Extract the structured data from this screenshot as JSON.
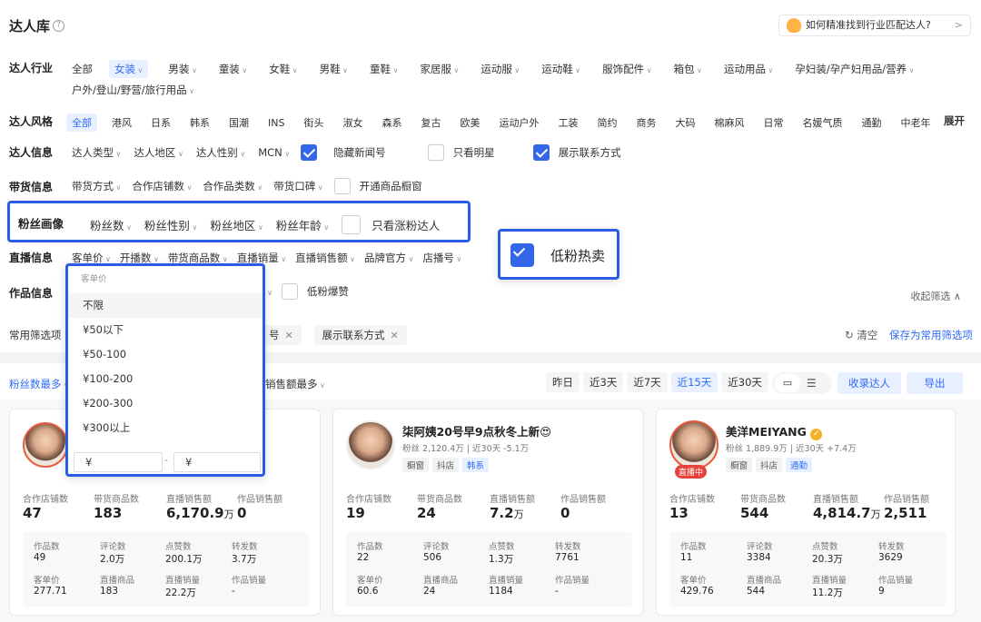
{
  "header": {
    "title": "达人库",
    "help": "?",
    "tip": "如何精准找到行业匹配达人?",
    "tip_arrow": ">"
  },
  "industry": {
    "label": "达人行业",
    "items": [
      "全部",
      "女装",
      "男装",
      "童装",
      "女鞋",
      "男鞋",
      "童鞋",
      "家居服",
      "运动服",
      "运动鞋",
      "服饰配件",
      "箱包",
      "运动用品",
      "孕妇装/孕产妇用品/营养",
      "户外/登山/野营/旅行用品"
    ]
  },
  "style": {
    "label": "达人风格",
    "items": [
      "全部",
      "港风",
      "日系",
      "韩系",
      "国潮",
      "INS",
      "街头",
      "淑女",
      "森系",
      "复古",
      "欧美",
      "运动户外",
      "工装",
      "简约",
      "商务",
      "大码",
      "棉麻风",
      "日常",
      "名媛气质",
      "通勤",
      "中老年"
    ],
    "expand": "展开"
  },
  "info": {
    "label": "达人信息",
    "dropdowns": [
      "达人类型",
      "达人地区",
      "达人性别",
      "MCN"
    ],
    "checks": [
      {
        "label": "隐藏新闻号",
        "checked": true
      },
      {
        "label": "只看明星",
        "checked": false
      },
      {
        "label": "展示联系方式",
        "checked": true
      }
    ]
  },
  "sales": {
    "label": "带货信息",
    "dropdowns": [
      "带货方式",
      "合作店铺数",
      "合作品类数",
      "带货口碑"
    ],
    "check": "开通商品橱窗"
  },
  "fans": {
    "label": "粉丝画像",
    "dropdowns": [
      "粉丝数",
      "粉丝性别",
      "粉丝地区",
      "粉丝年龄"
    ],
    "check": "只看涨粉达人"
  },
  "live": {
    "label": "直播信息",
    "dropdowns": [
      "客单价",
      "开播数",
      "带货商品数",
      "直播销量",
      "直播销售额",
      "品牌官方",
      "店播号"
    ]
  },
  "lowfans": {
    "label": "低粉热卖"
  },
  "works": {
    "label": "作品信息",
    "check": "低粉爆赞",
    "collapse": "收起筛选 ∧"
  },
  "common": {
    "label": "常用筛选项",
    "chips": [
      "号",
      "展示联系方式"
    ],
    "clear": "清空",
    "save": "保存为常用筛选项"
  },
  "price_dropdown": {
    "header": "客单价",
    "options": [
      "不限",
      "¥50以下",
      "¥50-100",
      "¥100-200",
      "¥200-300",
      "¥300以上"
    ],
    "min_placeholder": "¥",
    "max_placeholder": "¥",
    "dash": "-"
  },
  "toolbar": {
    "sort1": "粉丝数最多",
    "sort2": "销售额最多",
    "ranges": [
      "昨日",
      "近3天",
      "近7天",
      "近15天",
      "近30天"
    ],
    "active_range": "近15天",
    "collect": "收录达人",
    "export": "导出"
  },
  "cards": [
    {
      "name": "",
      "fans_line": "",
      "tags": [],
      "badge": "",
      "stats": [
        {
          "l": "合作店铺数",
          "v": "47"
        },
        {
          "l": "带货商品数",
          "v": "183"
        },
        {
          "l": "直播销售额",
          "v": "6,170.9",
          "u": "万"
        },
        {
          "l": "作品销售额",
          "v": "0"
        }
      ],
      "sub": [
        {
          "l": "作品数",
          "v": "49"
        },
        {
          "l": "评论数",
          "v": "2.0万"
        },
        {
          "l": "点赞数",
          "v": "200.1万"
        },
        {
          "l": "转发数",
          "v": "3.7万"
        },
        {
          "l": "客单价",
          "v": "277.71"
        },
        {
          "l": "直播商品",
          "v": "183"
        },
        {
          "l": "直播销量",
          "v": "22.2万"
        },
        {
          "l": "作品销量",
          "v": "-"
        }
      ]
    },
    {
      "name": "柒阿姨20号早9点秋冬上新😍",
      "fans_line": "粉丝 2,120.4万 | 近30天 -5.1万",
      "tags": [
        "橱窗",
        "抖店",
        "韩系"
      ],
      "badge": "",
      "stats": [
        {
          "l": "合作店铺数",
          "v": "19"
        },
        {
          "l": "带货商品数",
          "v": "24"
        },
        {
          "l": "直播销售额",
          "v": "7.2",
          "u": "万"
        },
        {
          "l": "作品销售额",
          "v": "0"
        }
      ],
      "sub": [
        {
          "l": "作品数",
          "v": "22"
        },
        {
          "l": "评论数",
          "v": "506"
        },
        {
          "l": "点赞数",
          "v": "1.3万"
        },
        {
          "l": "转发数",
          "v": "7761"
        },
        {
          "l": "客单价",
          "v": "60.6"
        },
        {
          "l": "直播商品",
          "v": "24"
        },
        {
          "l": "直播销量",
          "v": "1184"
        },
        {
          "l": "作品销量",
          "v": "-"
        }
      ]
    },
    {
      "name": "美洋MEIYANG",
      "fans_line": "粉丝 1,889.9万 | 近30天 +7.4万",
      "tags": [
        "橱窗",
        "抖店",
        "通勤"
      ],
      "badge": "直播中",
      "stats": [
        {
          "l": "合作店铺数",
          "v": "13"
        },
        {
          "l": "带货商品数",
          "v": "544"
        },
        {
          "l": "直播销售额",
          "v": "4,814.7",
          "u": "万"
        },
        {
          "l": "作品销售额",
          "v": "2,511"
        }
      ],
      "sub": [
        {
          "l": "作品数",
          "v": "11"
        },
        {
          "l": "评论数",
          "v": "3384"
        },
        {
          "l": "点赞数",
          "v": "20.3万"
        },
        {
          "l": "转发数",
          "v": "3629"
        },
        {
          "l": "客单价",
          "v": "429.76"
        },
        {
          "l": "直播商品",
          "v": "544"
        },
        {
          "l": "直播销量",
          "v": "11.2万"
        },
        {
          "l": "作品销量",
          "v": "9"
        }
      ]
    }
  ],
  "colors": {
    "accent": "#2f6cf6",
    "highlight": "#2b5ce6"
  }
}
